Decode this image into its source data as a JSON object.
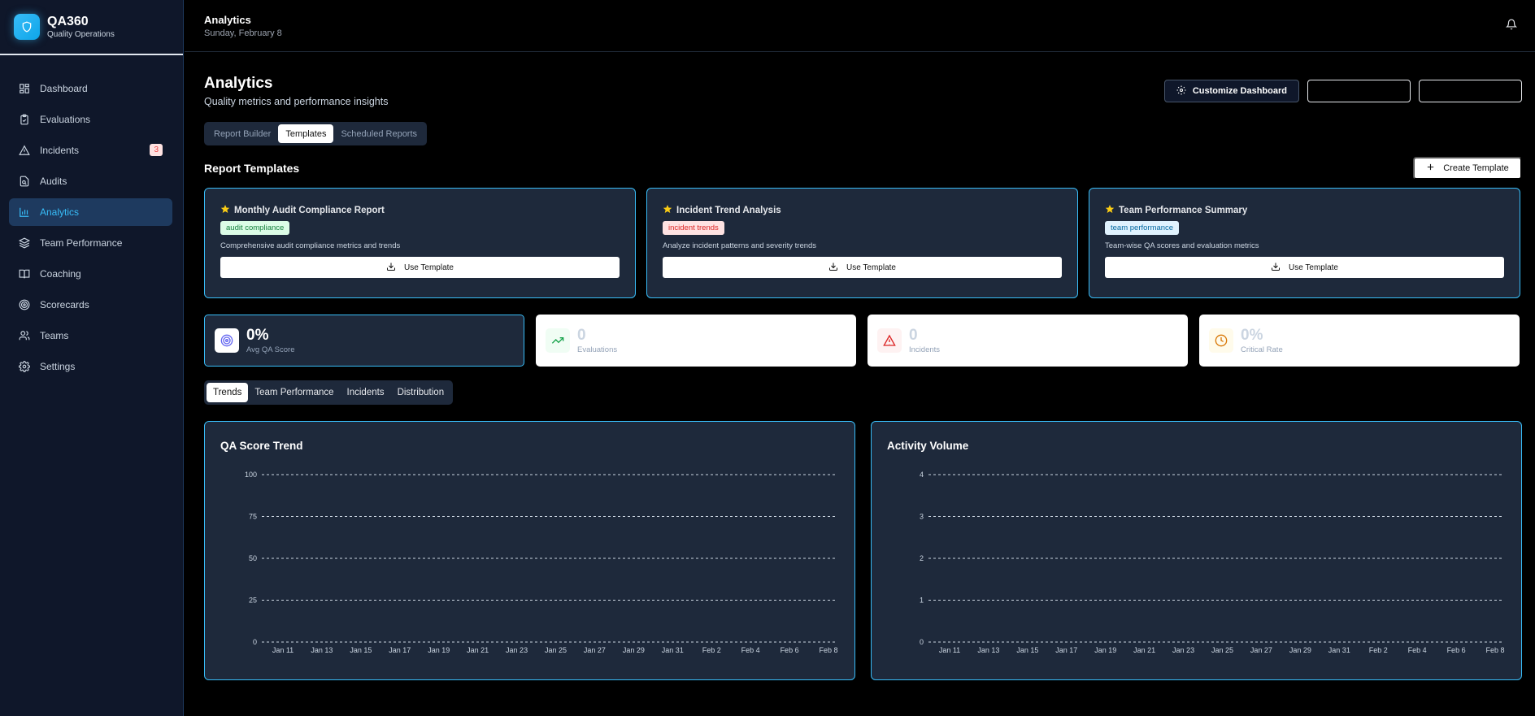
{
  "brand": {
    "name": "QA360",
    "subtitle": "Quality Operations"
  },
  "nav": [
    {
      "label": "Dashboard",
      "icon": "grid-icon"
    },
    {
      "label": "Evaluations",
      "icon": "clipboard-icon"
    },
    {
      "label": "Incidents",
      "icon": "alert-triangle-icon",
      "badge": "3"
    },
    {
      "label": "Audits",
      "icon": "file-search-icon"
    },
    {
      "label": "Analytics",
      "icon": "bar-chart-icon",
      "active": true
    },
    {
      "label": "Team Performance",
      "icon": "layers-icon"
    },
    {
      "label": "Coaching",
      "icon": "book-icon"
    },
    {
      "label": "Scorecards",
      "icon": "target-icon"
    },
    {
      "label": "Teams",
      "icon": "users-icon"
    },
    {
      "label": "Settings",
      "icon": "gear-icon"
    }
  ],
  "header": {
    "title": "Analytics",
    "date": "Sunday, February 8"
  },
  "page": {
    "title": "Analytics",
    "subtitle": "Quality metrics and performance insights",
    "customize_label": "Customize Dashboard"
  },
  "subtabs": [
    {
      "label": "Report Builder"
    },
    {
      "label": "Templates",
      "active": true
    },
    {
      "label": "Scheduled Reports"
    }
  ],
  "templates_section": {
    "title": "Report Templates",
    "create_label": "Create Template"
  },
  "templates": [
    {
      "title": "Monthly Audit Compliance Report",
      "tag": "audit compliance",
      "tag_style": "green",
      "description": "Comprehensive audit compliance metrics and trends",
      "button": "Use Template"
    },
    {
      "title": "Incident Trend Analysis",
      "tag": "incident trends",
      "tag_style": "red",
      "description": "Analyze incident patterns and severity trends",
      "button": "Use Template"
    },
    {
      "title": "Team Performance Summary",
      "tag": "team performance",
      "tag_style": "blue",
      "description": "Team-wise QA scores and evaluation metrics",
      "button": "Use Template"
    }
  ],
  "stats": [
    {
      "value": "0%",
      "label": "Avg QA Score",
      "icon": "target-icon",
      "color": "#6366f1",
      "dark": true
    },
    {
      "value": "0",
      "label": "Evaluations",
      "icon": "trending-up-icon",
      "color": "#16a34a"
    },
    {
      "value": "0",
      "label": "Incidents",
      "icon": "alert-triangle-icon",
      "color": "#dc2626"
    },
    {
      "value": "0%",
      "label": "Critical Rate",
      "icon": "clock-icon",
      "color": "#d97706"
    }
  ],
  "view_tabs": [
    {
      "label": "Trends",
      "active": true
    },
    {
      "label": "Team Performance"
    },
    {
      "label": "Incidents"
    },
    {
      "label": "Distribution"
    }
  ],
  "chart_data": [
    {
      "type": "line",
      "title": "QA Score Trend",
      "x": [
        "Jan 11",
        "Jan 13",
        "Jan 15",
        "Jan 17",
        "Jan 19",
        "Jan 21",
        "Jan 23",
        "Jan 25",
        "Jan 27",
        "Jan 29",
        "Jan 31",
        "Feb 2",
        "Feb 4",
        "Feb 6",
        "Feb 8"
      ],
      "y_ticks": [
        "0",
        "25",
        "50",
        "75",
        "100"
      ],
      "ylim": [
        0,
        100
      ],
      "grid": true,
      "series": []
    },
    {
      "type": "line",
      "title": "Activity Volume",
      "x": [
        "Jan 11",
        "Jan 13",
        "Jan 15",
        "Jan 17",
        "Jan 19",
        "Jan 21",
        "Jan 23",
        "Jan 25",
        "Jan 27",
        "Jan 29",
        "Jan 31",
        "Feb 2",
        "Feb 4",
        "Feb 6",
        "Feb 8"
      ],
      "y_ticks": [
        "0",
        "1",
        "2",
        "3",
        "4"
      ],
      "ylim": [
        0,
        4
      ],
      "grid": true,
      "series": []
    }
  ]
}
